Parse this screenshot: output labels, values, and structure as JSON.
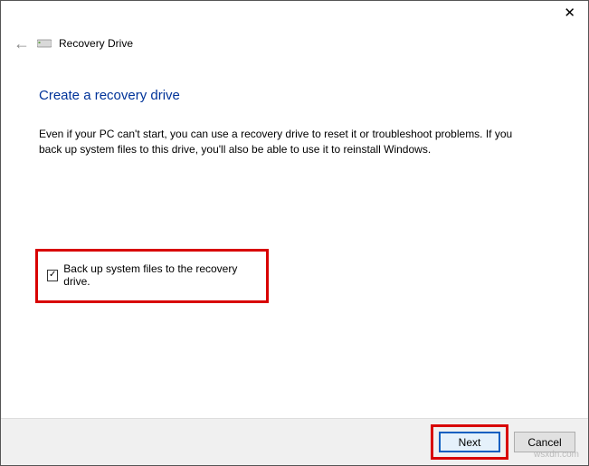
{
  "window": {
    "title": "Recovery Drive"
  },
  "page": {
    "heading": "Create a recovery drive",
    "description": "Even if your PC can't start, you can use a recovery drive to reset it or troubleshoot problems. If you back up system files to this drive, you'll also be able to use it to reinstall Windows."
  },
  "checkbox": {
    "label": "Back up system files to the recovery drive.",
    "checked": true
  },
  "buttons": {
    "next": "Next",
    "cancel": "Cancel"
  },
  "watermark": "wsxdn.com"
}
